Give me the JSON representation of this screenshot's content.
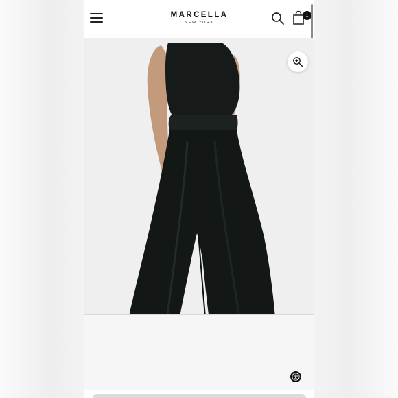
{
  "header": {
    "brand_name": "MARCELLA",
    "brand_sub": "NEW YORK",
    "cart_count": "1",
    "icons": {
      "menu": "hamburger-menu-icon",
      "search": "search-icon",
      "bag": "shopping-bag-icon",
      "zoom": "zoom-in-icon",
      "accessibility": "accessibility-icon"
    }
  },
  "product_image": {
    "alt": "Model wearing black sleeveless top and wide-leg velvet pants"
  },
  "colors": {
    "garment": "#141a18",
    "skin": "#c49a7c",
    "background": "#efefef"
  }
}
